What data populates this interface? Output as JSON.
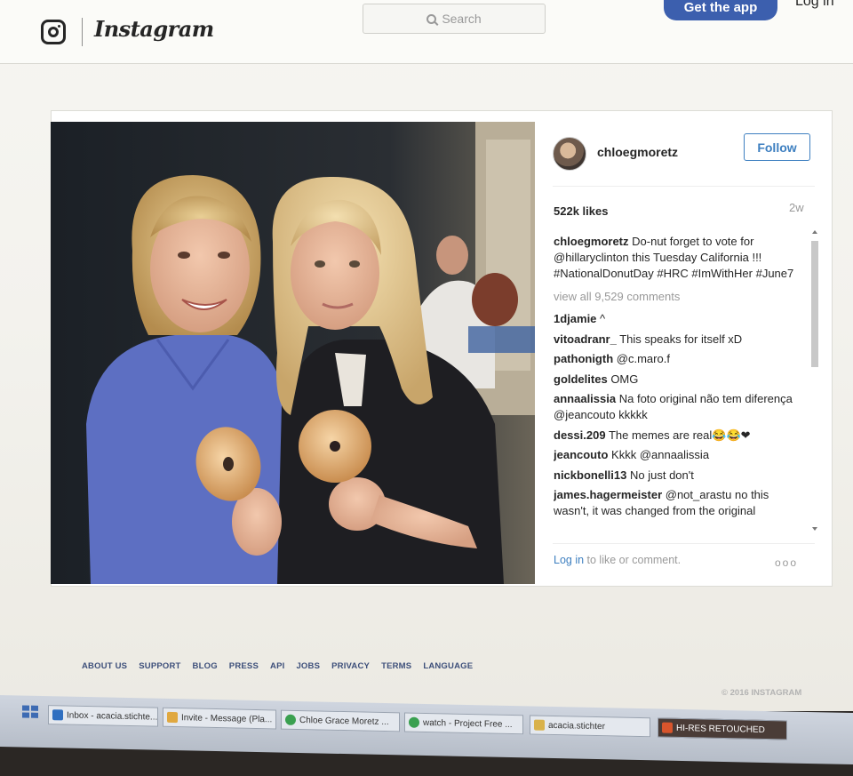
{
  "header": {
    "brand": "Instagram",
    "search_placeholder": "Search",
    "get_app_label": "Get the app",
    "login_label": "Log in"
  },
  "post": {
    "username": "chloegmoretz",
    "follow_label": "Follow",
    "likes": "522k likes",
    "time_ago": "2w",
    "caption": "Do-nut forget to vote for @hillaryclinton this Tuesday California !!! #NationalDonutDay #HRC #ImWithHer #June7",
    "view_all": "view all 9,529 comments",
    "comments": [
      {
        "user": "1djamie",
        "text": "^"
      },
      {
        "user": "vitoadranr_",
        "text": "This speaks for itself xD"
      },
      {
        "user": "pathonigth",
        "text": "@c.maro.f"
      },
      {
        "user": "goldelites",
        "text": "OMG"
      },
      {
        "user": "annaalissia",
        "text": "Na foto original não tem diferença @jeancouto kkkkk"
      },
      {
        "user": "dessi.209",
        "text": "The memes are real😂😂❤"
      },
      {
        "user": "jeancouto",
        "text": "Kkkk @annaalissia"
      },
      {
        "user": "nickbonelli13",
        "text": "No just don't"
      },
      {
        "user": "james.hagermeister",
        "text": "@not_arastu no this wasn't, it was changed from the original"
      }
    ],
    "login_link": "Log in",
    "login_hint": " to like or comment.",
    "more": "ooo"
  },
  "footer": {
    "links": [
      "ABOUT US",
      "SUPPORT",
      "BLOG",
      "PRESS",
      "API",
      "JOBS",
      "PRIVACY",
      "TERMS",
      "LANGUAGE"
    ],
    "copyright": "© 2016 INSTAGRAM"
  },
  "taskbar": {
    "items": [
      {
        "label": "Inbox - acacia.stichte...",
        "icon_color": "#2f6fc0"
      },
      {
        "label": "Invite - Message (Pla...",
        "icon_color": "#e0a840"
      },
      {
        "label": "Chloe Grace Moretz ...",
        "icon_color": "#3aa050"
      },
      {
        "label": "watch - Project Free ...",
        "icon_color": "#3aa050"
      },
      {
        "label": "acacia.stichter",
        "icon_color": "#d9b24a"
      },
      {
        "label": "HI-RES RETOUCHED",
        "icon_color": "#d8552c"
      }
    ]
  }
}
